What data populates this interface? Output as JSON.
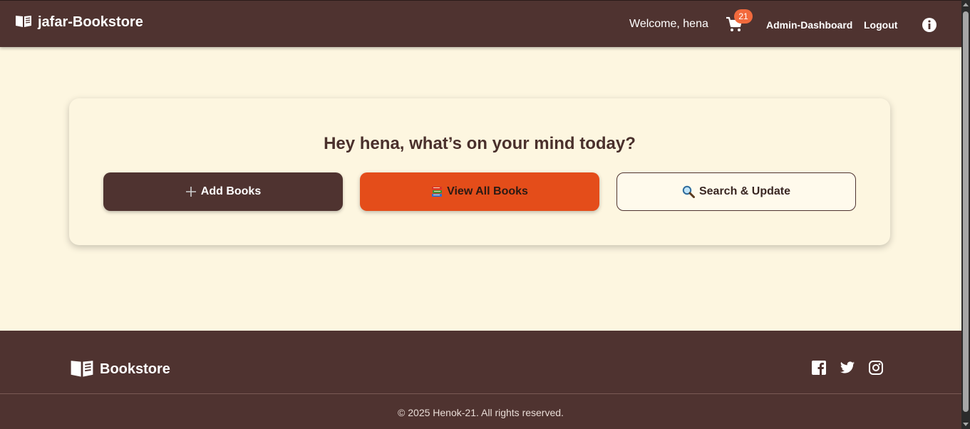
{
  "header": {
    "brand": "jafar-Bookstore",
    "brand_icon": "open-book-icon",
    "welcome": "Welcome, hena",
    "cart_count": "21",
    "cart_icon": "cart-icon",
    "admin_link": "Admin-Dashboard",
    "logout_link": "Logout",
    "info_icon": "info-icon"
  },
  "main": {
    "greeting": "Hey hena, what’s on your mind today?",
    "buttons": [
      {
        "label": "Add Books",
        "icon": "plus-icon"
      },
      {
        "label": "View All Books",
        "icon": "books-icon"
      },
      {
        "label": "Search & Update",
        "icon": "magnifier-icon"
      }
    ]
  },
  "footer": {
    "brand": "Bookstore",
    "brand_icon": "open-book-icon",
    "socials": [
      "facebook-icon",
      "twitter-icon",
      "instagram-icon"
    ],
    "copyright": "© 2025 Henok-21. All rights reserved."
  },
  "colors": {
    "brown": "#4f3330",
    "cream": "#fdf6e0",
    "orange": "#e44d1a",
    "badge": "#f26a3d"
  }
}
